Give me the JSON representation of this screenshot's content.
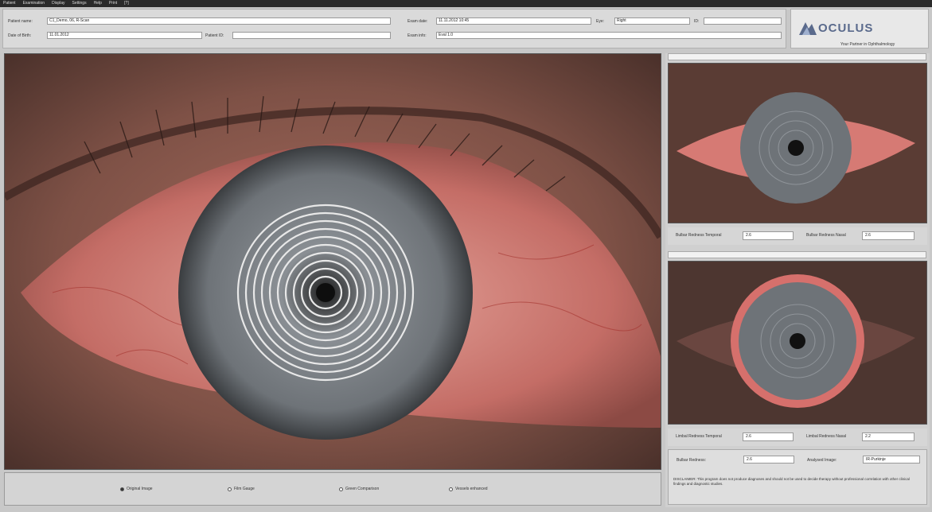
{
  "menu": [
    "Patient",
    "Examination",
    "Display",
    "Settings",
    "Help",
    "Print",
    "[?]"
  ],
  "header": {
    "patient_name_label": "Patient name:",
    "patient_name_value": "C1_Demo, 06, R-Scan",
    "dob_label": "Date of Birth:",
    "dob_value": "11.01.2012",
    "patient_id_label": "Patient ID:",
    "patient_id_value": "",
    "exam_date_label": "Exam date:",
    "exam_date_value": "11.11.2012 10:45",
    "eye_label": "Eye:",
    "eye_value": "Right",
    "id_label": "ID:",
    "id_value": "",
    "exam_info_label": "Exam info:",
    "exam_info_value": "Eval 1.0"
  },
  "logo": {
    "brand": "OCULUS",
    "tagline": "Your Partner in Ophthalmology",
    "brand_color": "#5a6a8c"
  },
  "view_options": [
    {
      "label": "Original Image",
      "selected": true
    },
    {
      "label": "Film Gauge",
      "selected": false
    },
    {
      "label": "Green Comparison",
      "selected": false
    },
    {
      "label": "Vessels enhanced",
      "selected": false
    }
  ],
  "bulbar": {
    "temporal_label": "Bulbar Redness Temporal",
    "temporal_value": "2.6",
    "nasal_label": "Bulbar Redness Nasal",
    "nasal_value": "2.6"
  },
  "limbal": {
    "temporal_label": "Limbal Redness Temporal",
    "temporal_value": "2.6",
    "nasal_label": "Limbal Redness Nasal",
    "nasal_value": "2.2"
  },
  "summary": {
    "bulbar_redness_label": "Bulbar Redness:",
    "bulbar_redness_value": "2.6",
    "analysed_image_label": "Analysed Image:",
    "analysed_image_value": "IR-Purkinje",
    "disclaimer": "DISCLAIMER: This program does not produce diagnoses and should not be used to decide therapy without professional correlation with other clinical findings and diagnostic studies."
  },
  "colors": {
    "sclera_red": "#c46d66",
    "iris_gray": "#6e7378",
    "skin": "#8a5a4e"
  }
}
